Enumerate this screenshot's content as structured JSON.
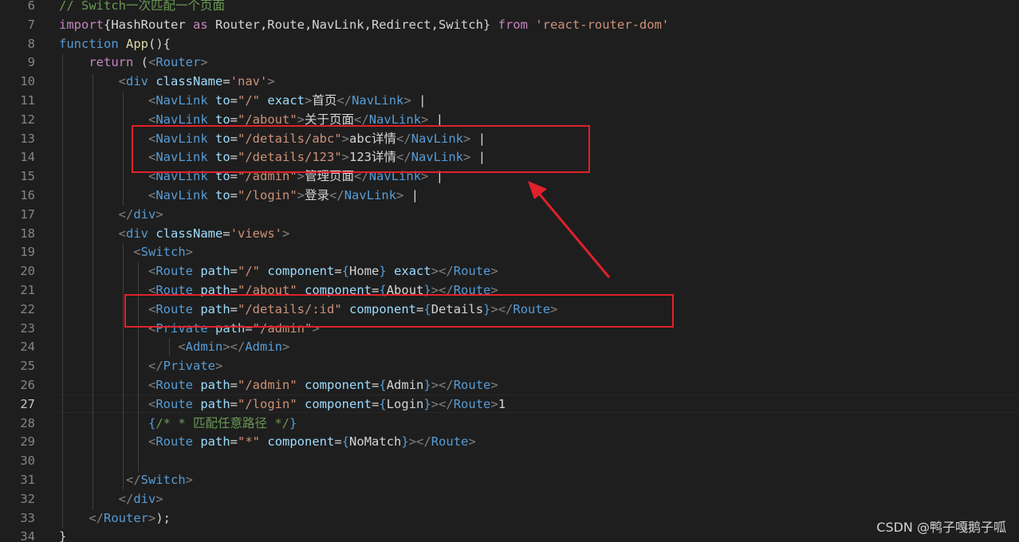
{
  "lines": [
    {
      "n": "6",
      "t": [
        {
          "c": "cmt",
          "v": "// Switch一次匹配一个页面"
        }
      ]
    },
    {
      "n": "7",
      "t": [
        {
          "c": "ctrl",
          "v": "import"
        },
        {
          "c": "txt",
          "v": "{HashRouter "
        },
        {
          "c": "ctrl",
          "v": "as"
        },
        {
          "c": "txt",
          "v": " Router,Route,NavLink,Redirect,Switch} "
        },
        {
          "c": "ctrl",
          "v": "from"
        },
        {
          "c": "txt",
          "v": " "
        },
        {
          "c": "str",
          "v": "'react-router-dom'"
        }
      ]
    },
    {
      "n": "8",
      "t": [
        {
          "c": "kw",
          "v": "function"
        },
        {
          "c": "txt",
          "v": " "
        },
        {
          "c": "fn",
          "v": "App"
        },
        {
          "c": "txt",
          "v": "(){"
        }
      ]
    },
    {
      "n": "9",
      "t": [
        {
          "c": "txt",
          "v": "    "
        },
        {
          "c": "ctrl",
          "v": "return"
        },
        {
          "c": "txt",
          "v": " ("
        },
        {
          "c": "brk",
          "v": "<"
        },
        {
          "c": "tag",
          "v": "Router"
        },
        {
          "c": "brk",
          "v": ">"
        }
      ]
    },
    {
      "n": "10",
      "t": [
        {
          "c": "txt",
          "v": "        "
        },
        {
          "c": "brk",
          "v": "<"
        },
        {
          "c": "tag",
          "v": "div"
        },
        {
          "c": "txt",
          "v": " "
        },
        {
          "c": "attr",
          "v": "className"
        },
        {
          "c": "txt",
          "v": "="
        },
        {
          "c": "str",
          "v": "'nav'"
        },
        {
          "c": "brk",
          "v": ">"
        }
      ]
    },
    {
      "n": "11",
      "t": [
        {
          "c": "txt",
          "v": "            "
        },
        {
          "c": "brk",
          "v": "<"
        },
        {
          "c": "tag",
          "v": "NavLink"
        },
        {
          "c": "txt",
          "v": " "
        },
        {
          "c": "attr",
          "v": "to"
        },
        {
          "c": "txt",
          "v": "="
        },
        {
          "c": "str",
          "v": "\"/\""
        },
        {
          "c": "txt",
          "v": " "
        },
        {
          "c": "attr",
          "v": "exact"
        },
        {
          "c": "brk",
          "v": ">"
        },
        {
          "c": "txt",
          "v": "首页"
        },
        {
          "c": "brk",
          "v": "</"
        },
        {
          "c": "tag",
          "v": "NavLink"
        },
        {
          "c": "brk",
          "v": ">"
        },
        {
          "c": "txt",
          "v": " |"
        }
      ]
    },
    {
      "n": "12",
      "t": [
        {
          "c": "txt",
          "v": "            "
        },
        {
          "c": "brk",
          "v": "<"
        },
        {
          "c": "tag",
          "v": "NavLink"
        },
        {
          "c": "txt",
          "v": " "
        },
        {
          "c": "attr",
          "v": "to"
        },
        {
          "c": "txt",
          "v": "="
        },
        {
          "c": "str",
          "v": "\"/about\""
        },
        {
          "c": "brk",
          "v": ">"
        },
        {
          "c": "txt",
          "v": "关于页面"
        },
        {
          "c": "brk",
          "v": "</"
        },
        {
          "c": "tag",
          "v": "NavLink"
        },
        {
          "c": "brk",
          "v": ">"
        },
        {
          "c": "txt",
          "v": " |"
        }
      ]
    },
    {
      "n": "13",
      "t": [
        {
          "c": "txt",
          "v": "            "
        },
        {
          "c": "brk",
          "v": "<"
        },
        {
          "c": "tag",
          "v": "NavLink"
        },
        {
          "c": "txt",
          "v": " "
        },
        {
          "c": "attr",
          "v": "to"
        },
        {
          "c": "txt",
          "v": "="
        },
        {
          "c": "str",
          "v": "\"/details/abc\""
        },
        {
          "c": "brk",
          "v": ">"
        },
        {
          "c": "txt",
          "v": "abc详情"
        },
        {
          "c": "brk",
          "v": "</"
        },
        {
          "c": "tag",
          "v": "NavLink"
        },
        {
          "c": "brk",
          "v": ">"
        },
        {
          "c": "txt",
          "v": " |"
        }
      ]
    },
    {
      "n": "14",
      "t": [
        {
          "c": "txt",
          "v": "            "
        },
        {
          "c": "brk",
          "v": "<"
        },
        {
          "c": "tag",
          "v": "NavLink"
        },
        {
          "c": "txt",
          "v": " "
        },
        {
          "c": "attr",
          "v": "to"
        },
        {
          "c": "txt",
          "v": "="
        },
        {
          "c": "str",
          "v": "\"/details/123\""
        },
        {
          "c": "brk",
          "v": ">"
        },
        {
          "c": "txt",
          "v": "123详情"
        },
        {
          "c": "brk",
          "v": "</"
        },
        {
          "c": "tag",
          "v": "NavLink"
        },
        {
          "c": "brk",
          "v": ">"
        },
        {
          "c": "txt",
          "v": " |"
        }
      ]
    },
    {
      "n": "15",
      "t": [
        {
          "c": "txt",
          "v": "            "
        },
        {
          "c": "brk",
          "v": "<"
        },
        {
          "c": "tag",
          "v": "NavLink"
        },
        {
          "c": "txt",
          "v": " "
        },
        {
          "c": "attr",
          "v": "to"
        },
        {
          "c": "txt",
          "v": "="
        },
        {
          "c": "str",
          "v": "\"/admin\""
        },
        {
          "c": "brk",
          "v": ">"
        },
        {
          "c": "txt",
          "v": "管理页面"
        },
        {
          "c": "brk",
          "v": "</"
        },
        {
          "c": "tag",
          "v": "NavLink"
        },
        {
          "c": "brk",
          "v": ">"
        },
        {
          "c": "txt",
          "v": " |"
        }
      ]
    },
    {
      "n": "16",
      "t": [
        {
          "c": "txt",
          "v": "            "
        },
        {
          "c": "brk",
          "v": "<"
        },
        {
          "c": "tag",
          "v": "NavLink"
        },
        {
          "c": "txt",
          "v": " "
        },
        {
          "c": "attr",
          "v": "to"
        },
        {
          "c": "txt",
          "v": "="
        },
        {
          "c": "str",
          "v": "\"/login\""
        },
        {
          "c": "brk",
          "v": ">"
        },
        {
          "c": "txt",
          "v": "登录"
        },
        {
          "c": "brk",
          "v": "</"
        },
        {
          "c": "tag",
          "v": "NavLink"
        },
        {
          "c": "brk",
          "v": ">"
        },
        {
          "c": "txt",
          "v": " |"
        }
      ]
    },
    {
      "n": "17",
      "t": [
        {
          "c": "txt",
          "v": "        "
        },
        {
          "c": "brk",
          "v": "</"
        },
        {
          "c": "tag",
          "v": "div"
        },
        {
          "c": "brk",
          "v": ">"
        }
      ]
    },
    {
      "n": "18",
      "t": [
        {
          "c": "txt",
          "v": "        "
        },
        {
          "c": "brk",
          "v": "<"
        },
        {
          "c": "tag",
          "v": "div"
        },
        {
          "c": "txt",
          "v": " "
        },
        {
          "c": "attr",
          "v": "className"
        },
        {
          "c": "txt",
          "v": "="
        },
        {
          "c": "str",
          "v": "'views'"
        },
        {
          "c": "brk",
          "v": ">"
        }
      ]
    },
    {
      "n": "19",
      "t": [
        {
          "c": "txt",
          "v": "          "
        },
        {
          "c": "brk",
          "v": "<"
        },
        {
          "c": "tag",
          "v": "Switch"
        },
        {
          "c": "brk",
          "v": ">"
        }
      ]
    },
    {
      "n": "20",
      "t": [
        {
          "c": "txt",
          "v": "            "
        },
        {
          "c": "brk",
          "v": "<"
        },
        {
          "c": "tag",
          "v": "Route"
        },
        {
          "c": "txt",
          "v": " "
        },
        {
          "c": "attr",
          "v": "path"
        },
        {
          "c": "txt",
          "v": "="
        },
        {
          "c": "str",
          "v": "\"/\""
        },
        {
          "c": "txt",
          "v": " "
        },
        {
          "c": "attr",
          "v": "component"
        },
        {
          "c": "txt",
          "v": "="
        },
        {
          "c": "brace",
          "v": "{"
        },
        {
          "c": "txt",
          "v": "Home"
        },
        {
          "c": "brace",
          "v": "}"
        },
        {
          "c": "txt",
          "v": " "
        },
        {
          "c": "attr",
          "v": "exact"
        },
        {
          "c": "brk",
          "v": "></"
        },
        {
          "c": "tag",
          "v": "Route"
        },
        {
          "c": "brk",
          "v": ">"
        }
      ]
    },
    {
      "n": "21",
      "t": [
        {
          "c": "txt",
          "v": "            "
        },
        {
          "c": "brk",
          "v": "<"
        },
        {
          "c": "tag",
          "v": "Route"
        },
        {
          "c": "txt",
          "v": " "
        },
        {
          "c": "attr",
          "v": "path"
        },
        {
          "c": "txt",
          "v": "="
        },
        {
          "c": "str",
          "v": "\"/about\""
        },
        {
          "c": "txt",
          "v": " "
        },
        {
          "c": "attr",
          "v": "component"
        },
        {
          "c": "txt",
          "v": "="
        },
        {
          "c": "brace",
          "v": "{"
        },
        {
          "c": "txt",
          "v": "About"
        },
        {
          "c": "brace",
          "v": "}"
        },
        {
          "c": "brk",
          "v": "></"
        },
        {
          "c": "tag",
          "v": "Route"
        },
        {
          "c": "brk",
          "v": ">"
        }
      ]
    },
    {
      "n": "22",
      "t": [
        {
          "c": "txt",
          "v": "            "
        },
        {
          "c": "brk",
          "v": "<"
        },
        {
          "c": "tag",
          "v": "Route"
        },
        {
          "c": "txt",
          "v": " "
        },
        {
          "c": "attr",
          "v": "path"
        },
        {
          "c": "txt",
          "v": "="
        },
        {
          "c": "str",
          "v": "\"/details/:id\""
        },
        {
          "c": "txt",
          "v": " "
        },
        {
          "c": "attr",
          "v": "component"
        },
        {
          "c": "txt",
          "v": "="
        },
        {
          "c": "brace",
          "v": "{"
        },
        {
          "c": "txt",
          "v": "Details"
        },
        {
          "c": "brace",
          "v": "}"
        },
        {
          "c": "brk",
          "v": "></"
        },
        {
          "c": "tag",
          "v": "Route"
        },
        {
          "c": "brk",
          "v": ">"
        }
      ]
    },
    {
      "n": "23",
      "t": [
        {
          "c": "txt",
          "v": "            "
        },
        {
          "c": "brk",
          "v": "<"
        },
        {
          "c": "tag",
          "v": "Private"
        },
        {
          "c": "txt",
          "v": " "
        },
        {
          "c": "attr",
          "v": "path"
        },
        {
          "c": "txt",
          "v": "="
        },
        {
          "c": "str",
          "v": "\"/admin\""
        },
        {
          "c": "brk",
          "v": ">"
        }
      ]
    },
    {
      "n": "24",
      "t": [
        {
          "c": "txt",
          "v": "                "
        },
        {
          "c": "brk",
          "v": "<"
        },
        {
          "c": "tag",
          "v": "Admin"
        },
        {
          "c": "brk",
          "v": "></"
        },
        {
          "c": "tag",
          "v": "Admin"
        },
        {
          "c": "brk",
          "v": ">"
        }
      ]
    },
    {
      "n": "25",
      "t": [
        {
          "c": "txt",
          "v": "            "
        },
        {
          "c": "brk",
          "v": "</"
        },
        {
          "c": "tag",
          "v": "Private"
        },
        {
          "c": "brk",
          "v": ">"
        }
      ]
    },
    {
      "n": "26",
      "t": [
        {
          "c": "txt",
          "v": "            "
        },
        {
          "c": "brk",
          "v": "<"
        },
        {
          "c": "tag",
          "v": "Route"
        },
        {
          "c": "txt",
          "v": " "
        },
        {
          "c": "attr",
          "v": "path"
        },
        {
          "c": "txt",
          "v": "="
        },
        {
          "c": "str",
          "v": "\"/admin\""
        },
        {
          "c": "txt",
          "v": " "
        },
        {
          "c": "attr",
          "v": "component"
        },
        {
          "c": "txt",
          "v": "="
        },
        {
          "c": "brace",
          "v": "{"
        },
        {
          "c": "txt",
          "v": "Admin"
        },
        {
          "c": "brace",
          "v": "}"
        },
        {
          "c": "brk",
          "v": "></"
        },
        {
          "c": "tag",
          "v": "Route"
        },
        {
          "c": "brk",
          "v": ">"
        }
      ]
    },
    {
      "n": "27",
      "t": [
        {
          "c": "txt",
          "v": "            "
        },
        {
          "c": "brk",
          "v": "<"
        },
        {
          "c": "tag",
          "v": "Route"
        },
        {
          "c": "txt",
          "v": " "
        },
        {
          "c": "attr",
          "v": "path"
        },
        {
          "c": "txt",
          "v": "="
        },
        {
          "c": "str",
          "v": "\"/login\""
        },
        {
          "c": "txt",
          "v": " "
        },
        {
          "c": "attr",
          "v": "component"
        },
        {
          "c": "txt",
          "v": "="
        },
        {
          "c": "brace",
          "v": "{"
        },
        {
          "c": "txt",
          "v": "Login"
        },
        {
          "c": "brace",
          "v": "}"
        },
        {
          "c": "brk",
          "v": "></"
        },
        {
          "c": "tag",
          "v": "Route"
        },
        {
          "c": "brk",
          "v": ">"
        },
        {
          "c": "txt",
          "v": "1"
        }
      ]
    },
    {
      "n": "28",
      "t": [
        {
          "c": "txt",
          "v": "            "
        },
        {
          "c": "brace",
          "v": "{"
        },
        {
          "c": "cmt",
          "v": "/* * 匹配任意路径 */"
        },
        {
          "c": "brace",
          "v": "}"
        }
      ]
    },
    {
      "n": "29",
      "t": [
        {
          "c": "txt",
          "v": "            "
        },
        {
          "c": "brk",
          "v": "<"
        },
        {
          "c": "tag",
          "v": "Route"
        },
        {
          "c": "txt",
          "v": " "
        },
        {
          "c": "attr",
          "v": "path"
        },
        {
          "c": "txt",
          "v": "="
        },
        {
          "c": "str",
          "v": "\"*\""
        },
        {
          "c": "txt",
          "v": " "
        },
        {
          "c": "attr",
          "v": "component"
        },
        {
          "c": "txt",
          "v": "="
        },
        {
          "c": "brace",
          "v": "{"
        },
        {
          "c": "txt",
          "v": "NoMatch"
        },
        {
          "c": "brace",
          "v": "}"
        },
        {
          "c": "brk",
          "v": "></"
        },
        {
          "c": "tag",
          "v": "Route"
        },
        {
          "c": "brk",
          "v": ">"
        }
      ]
    },
    {
      "n": "30",
      "t": []
    },
    {
      "n": "31",
      "t": [
        {
          "c": "txt",
          "v": "         "
        },
        {
          "c": "brk",
          "v": "</"
        },
        {
          "c": "tag",
          "v": "Switch"
        },
        {
          "c": "brk",
          "v": ">"
        }
      ]
    },
    {
      "n": "32",
      "t": [
        {
          "c": "txt",
          "v": "        "
        },
        {
          "c": "brk",
          "v": "</"
        },
        {
          "c": "tag",
          "v": "div"
        },
        {
          "c": "brk",
          "v": ">"
        }
      ]
    },
    {
      "n": "33",
      "t": [
        {
          "c": "txt",
          "v": "    "
        },
        {
          "c": "brk",
          "v": "</"
        },
        {
          "c": "tag",
          "v": "Router"
        },
        {
          "c": "brk",
          "v": ">"
        },
        {
          "c": "txt",
          "v": ");"
        }
      ]
    },
    {
      "n": "34",
      "t": [
        {
          "c": "txt",
          "v": "}"
        }
      ]
    }
  ],
  "active_line": "27",
  "watermark": "CSDN @鸭子嘎鹅子呱",
  "colors": {
    "background": "#1e1e1e",
    "annotation": "#e0212a",
    "keyword": "#569cd6",
    "control": "#c586c0",
    "string": "#ce9178",
    "attribute": "#9cdcfe",
    "comment": "#6a9955"
  }
}
